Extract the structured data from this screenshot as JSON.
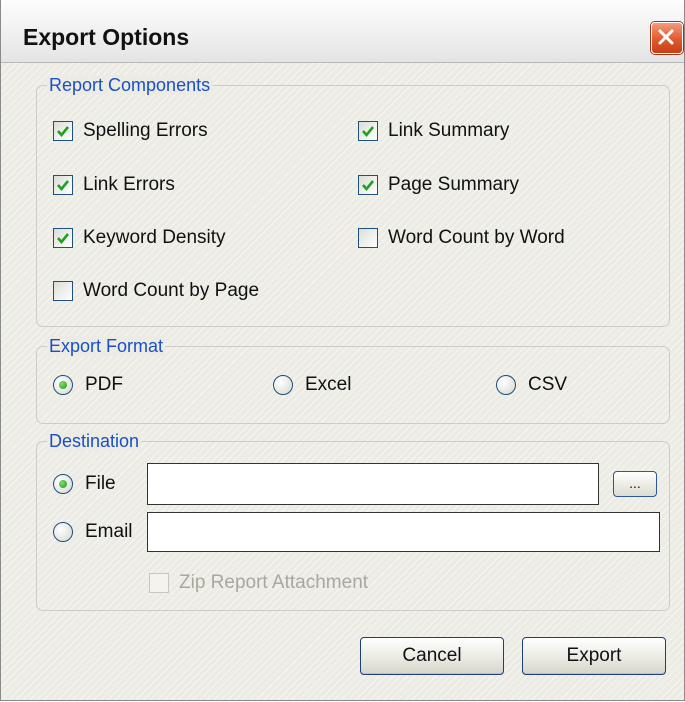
{
  "window": {
    "title": "Export Options"
  },
  "report_components": {
    "legend": "Report Components",
    "items": [
      {
        "label": "Spelling Errors",
        "checked": true
      },
      {
        "label": "Link Summary",
        "checked": true
      },
      {
        "label": "Link Errors",
        "checked": true
      },
      {
        "label": "Page Summary",
        "checked": true
      },
      {
        "label": "Keyword Density",
        "checked": true
      },
      {
        "label": "Word Count by Word",
        "checked": false
      },
      {
        "label": "Word Count by Page",
        "checked": false
      }
    ]
  },
  "export_format": {
    "legend": "Export Format",
    "options": [
      {
        "label": "PDF",
        "selected": true
      },
      {
        "label": "Excel",
        "selected": false
      },
      {
        "label": "CSV",
        "selected": false
      }
    ]
  },
  "destination": {
    "legend": "Destination",
    "file_label": "File",
    "file_selected": true,
    "file_value": "",
    "browse_label": "...",
    "email_label": "Email",
    "email_selected": false,
    "email_value": "",
    "zip_label": "Zip Report Attachment",
    "zip_checked": false,
    "zip_enabled": false
  },
  "buttons": {
    "cancel": "Cancel",
    "export": "Export"
  },
  "colors": {
    "legend_text": "#1a4fc8",
    "close_button": "#e05a2f",
    "check_mark": "#21a121"
  }
}
